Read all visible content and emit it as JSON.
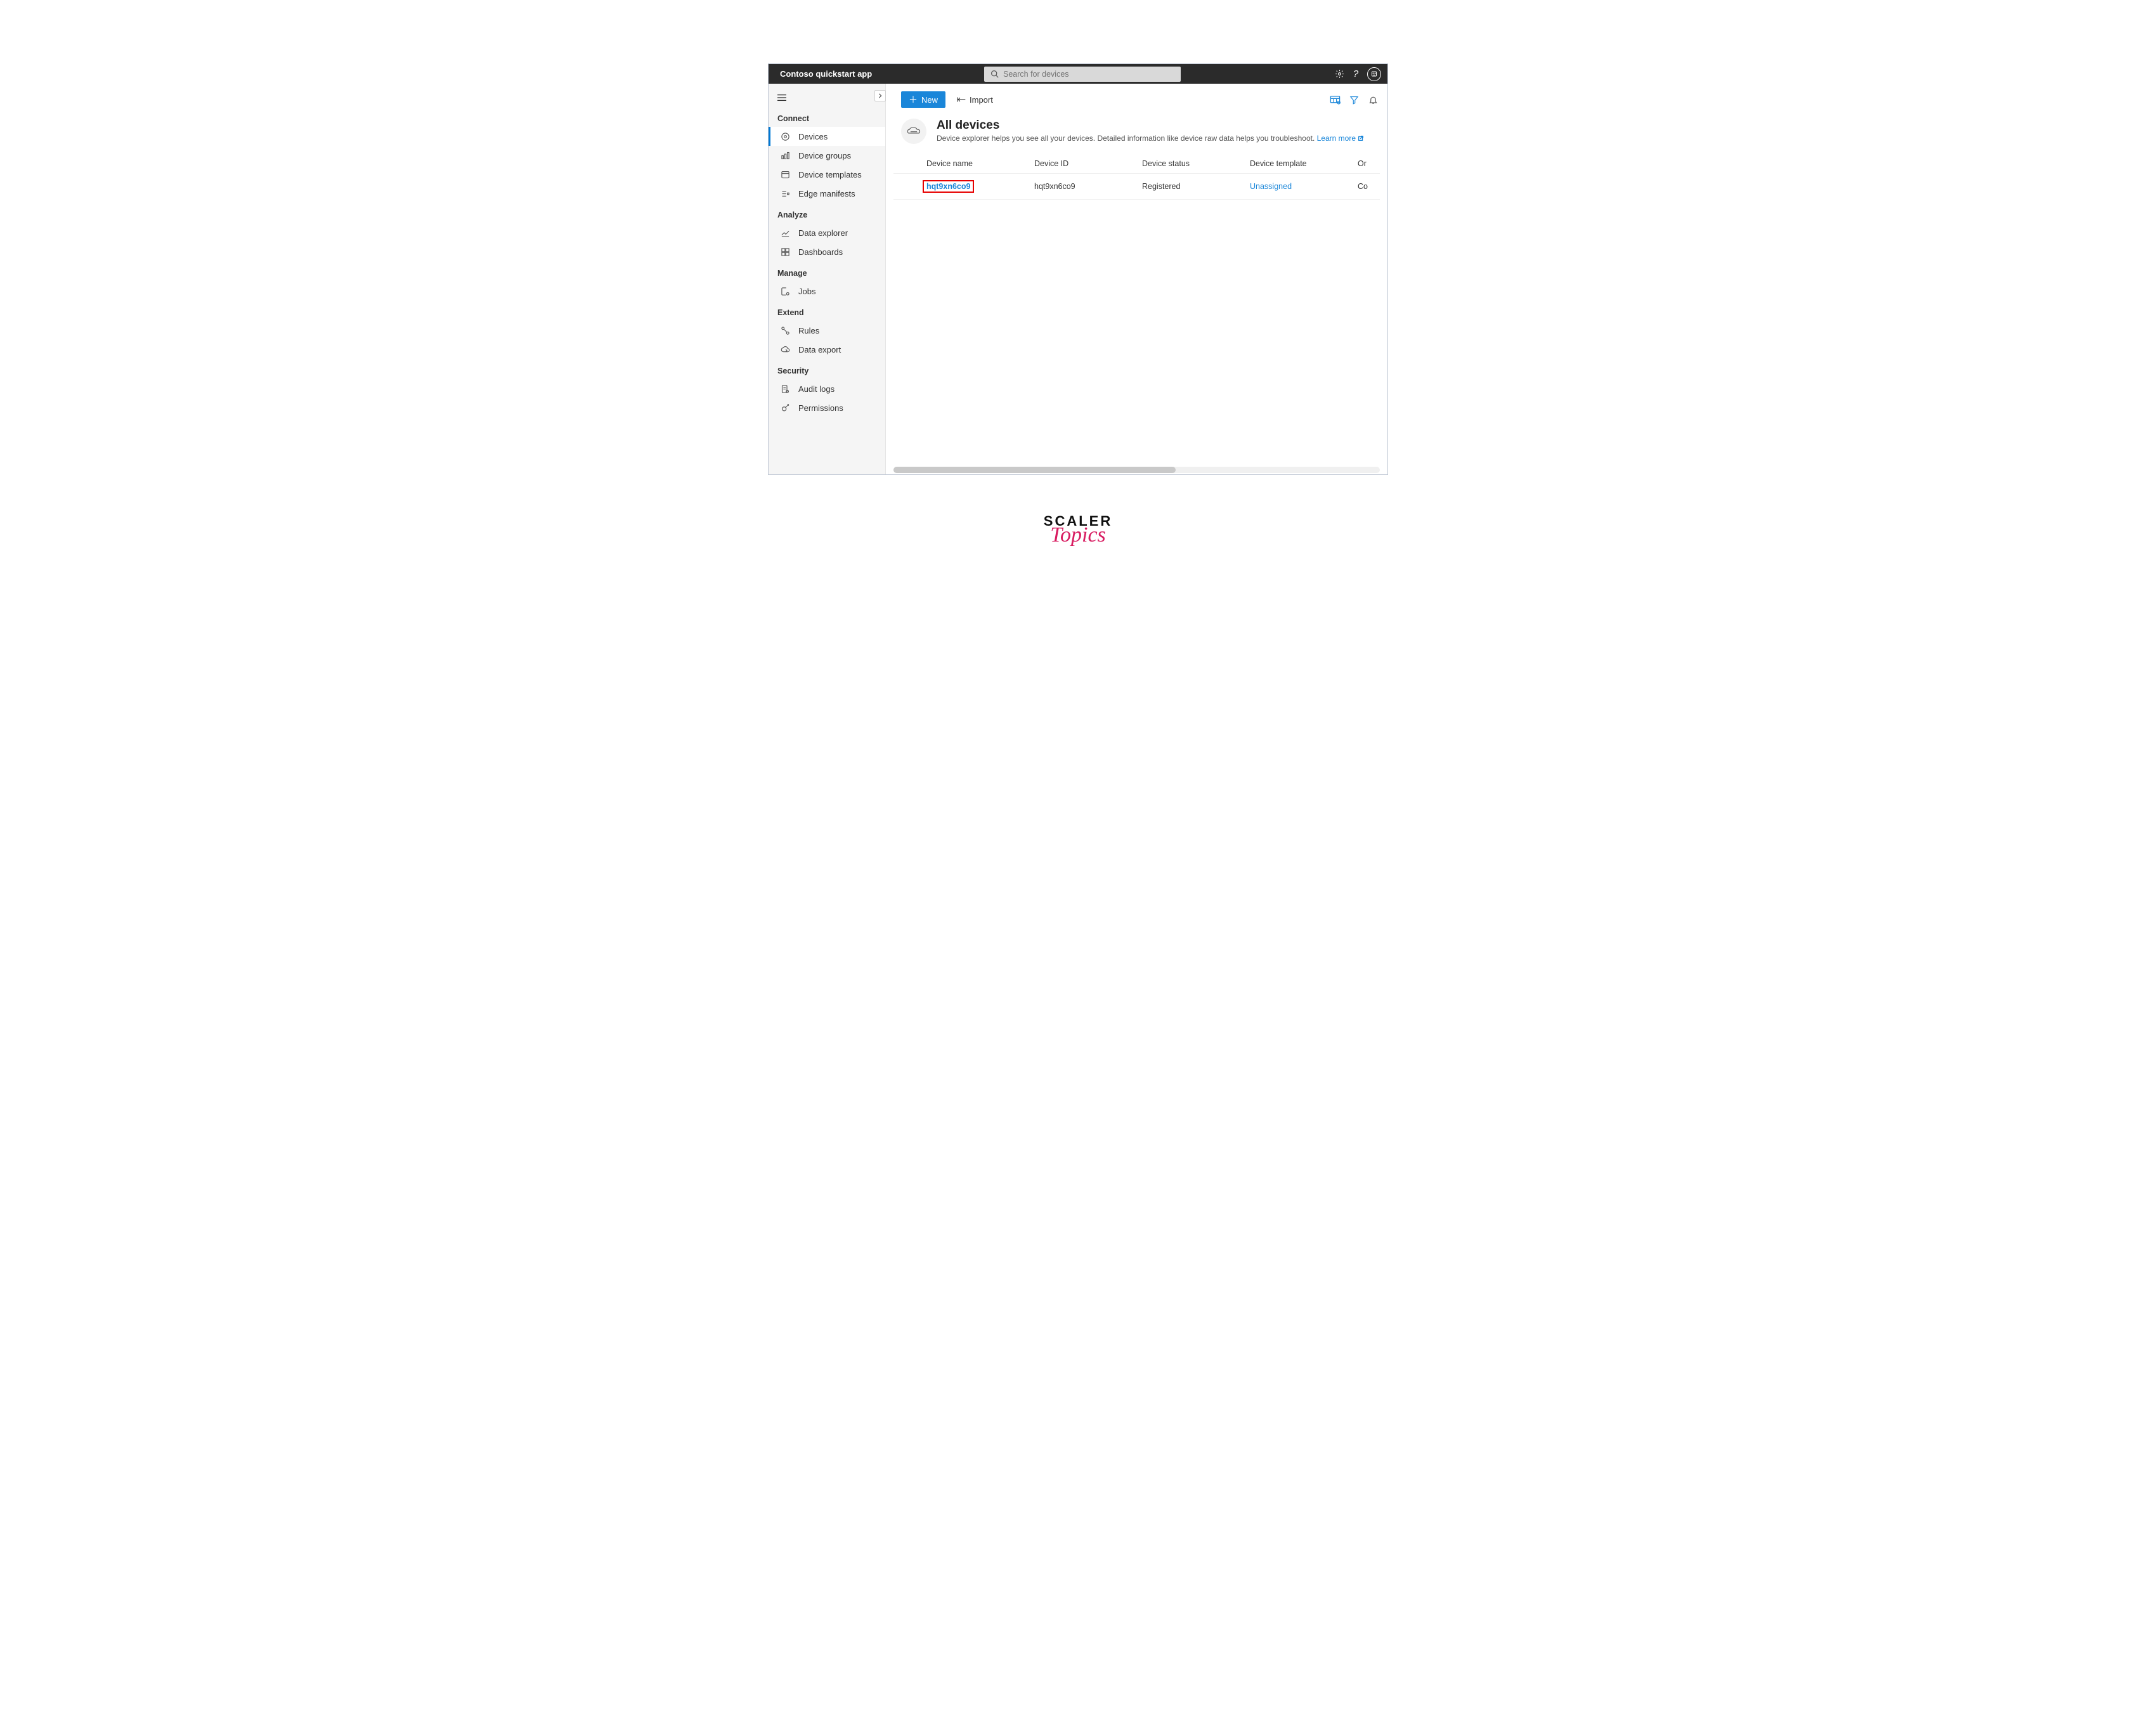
{
  "header": {
    "app_name": "Contoso quickstart app",
    "search_placeholder": "Search for devices"
  },
  "sidebar": {
    "sections": [
      {
        "label": "Connect",
        "items": [
          {
            "icon": "devices-icon",
            "label": "Devices",
            "active": true
          },
          {
            "icon": "device-groups-icon",
            "label": "Device groups"
          },
          {
            "icon": "device-templates-icon",
            "label": "Device templates"
          },
          {
            "icon": "edge-manifests-icon",
            "label": "Edge manifests"
          }
        ]
      },
      {
        "label": "Analyze",
        "items": [
          {
            "icon": "data-explorer-icon",
            "label": "Data explorer"
          },
          {
            "icon": "dashboards-icon",
            "label": "Dashboards"
          }
        ]
      },
      {
        "label": "Manage",
        "items": [
          {
            "icon": "jobs-icon",
            "label": "Jobs"
          }
        ]
      },
      {
        "label": "Extend",
        "items": [
          {
            "icon": "rules-icon",
            "label": "Rules"
          },
          {
            "icon": "data-export-icon",
            "label": "Data export"
          }
        ]
      },
      {
        "label": "Security",
        "items": [
          {
            "icon": "audit-logs-icon",
            "label": "Audit logs"
          },
          {
            "icon": "permissions-icon",
            "label": "Permissions"
          }
        ]
      }
    ]
  },
  "toolbar": {
    "new_label": "New",
    "import_label": "Import"
  },
  "page": {
    "title": "All devices",
    "subtitle": "Device explorer helps you see all your devices. Detailed information like device raw data helps you troubleshoot. ",
    "learn_more": "Learn more"
  },
  "table": {
    "columns": [
      "Device name",
      "Device ID",
      "Device status",
      "Device template",
      "Or"
    ],
    "rows": [
      {
        "name": "hqt9xn6co9",
        "id": "hqt9xn6co9",
        "status": "Registered",
        "template": "Unassigned",
        "org": "Co"
      }
    ]
  },
  "brand": {
    "line1": "SCALER",
    "line2": "Topics"
  }
}
